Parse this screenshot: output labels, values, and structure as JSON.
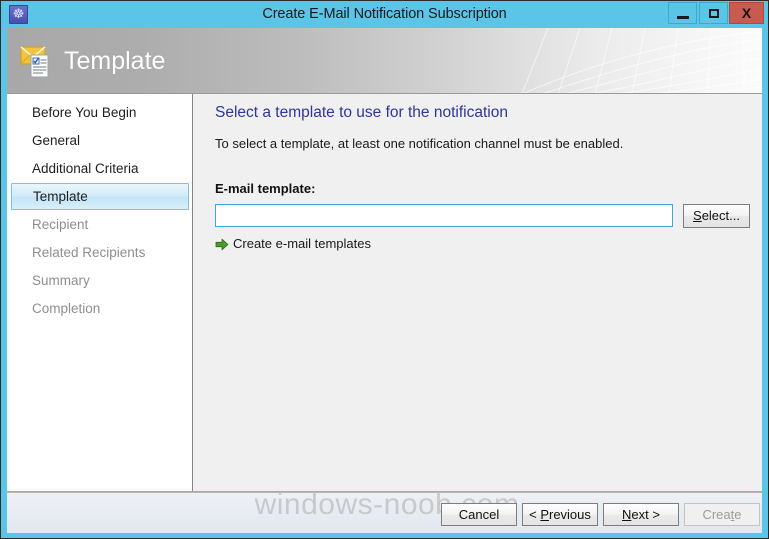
{
  "window": {
    "title": "Create E-Mail Notification Subscription",
    "app_icon": "subscription-icon",
    "controls": {
      "minimize": "minimize-button",
      "maximize": "maximize-button",
      "close_label": "X"
    },
    "titlebar_color": "#5bc5e8",
    "close_color": "#c75b52"
  },
  "header": {
    "title": "Template",
    "icon": "email-template-icon"
  },
  "sidebar": {
    "items": [
      {
        "label": "Before You Begin",
        "state": "normal"
      },
      {
        "label": "General",
        "state": "normal"
      },
      {
        "label": "Additional Criteria",
        "state": "normal"
      },
      {
        "label": "Template",
        "state": "selected"
      },
      {
        "label": "Recipient",
        "state": "disabled"
      },
      {
        "label": "Related Recipients",
        "state": "disabled"
      },
      {
        "label": "Summary",
        "state": "disabled"
      },
      {
        "label": "Completion",
        "state": "disabled"
      }
    ],
    "selected_accent": "#7cc3e0"
  },
  "content": {
    "heading": "Select a template to use for the notification",
    "heading_color": "#2f3699",
    "subtext": "To select a template, at least one notification channel must be enabled.",
    "field_label": "E-mail template:",
    "template_value": "",
    "template_placeholder": "",
    "select_button": "Select...",
    "select_button_accesskey": "S",
    "create_link": "Create e-mail templates",
    "create_link_icon": "green-arrow-icon",
    "create_link_icon_color": "#4b9b2f"
  },
  "footer": {
    "watermark": "windows-noob.com",
    "buttons": [
      {
        "id": "cancel",
        "label": "Cancel",
        "accesskey": "",
        "enabled": true
      },
      {
        "id": "previous",
        "label": "< Previous",
        "accesskey": "P",
        "enabled": true
      },
      {
        "id": "next",
        "label": "Next >",
        "accesskey": "N",
        "enabled": true
      },
      {
        "id": "create",
        "label": "Create",
        "accesskey": "t",
        "enabled": false
      }
    ]
  }
}
